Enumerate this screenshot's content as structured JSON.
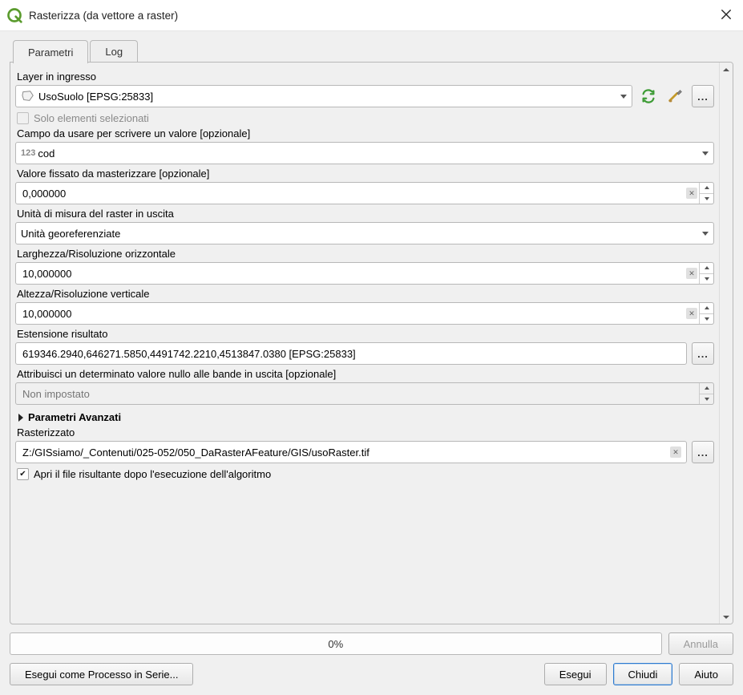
{
  "window": {
    "title": "Rasterizza (da vettore a raster)"
  },
  "tabs": {
    "parametri": "Parametri",
    "log": "Log"
  },
  "labels": {
    "layer_in": "Layer in ingresso",
    "solo_sel": "Solo elementi selezionati",
    "campo": "Campo da usare per scrivere un valore [opzionale]",
    "valore_fissato": "Valore fissato da masterizzare [opzionale]",
    "unita": "Unità di misura del raster in uscita",
    "larghezza": "Larghezza/Risoluzione orizzontale",
    "altezza": "Altezza/Risoluzione verticale",
    "estensione": "Estensione risultato",
    "nullo": "Attribuisci un determinato valore nullo alle bande in uscita [opzionale]",
    "avanzati": "Parametri Avanzati",
    "rasterizzato": "Rasterizzato",
    "apri_file": "Apri il file risultante dopo l'esecuzione dell'algoritmo"
  },
  "values": {
    "layer": "UsoSuolo [EPSG:25833]",
    "campo": "cod",
    "valore_fissato": "0,000000",
    "unita": "Unità georeferenziate",
    "larghezza": "10,000000",
    "altezza": "10,000000",
    "estensione": "619346.2940,646271.5850,4491742.2210,4513847.0380 [EPSG:25833]",
    "nullo_placeholder": "Non impostato",
    "output": "Z:/GISsiamo/_Contenuti/025-052/050_DaRasterAFeature/GIS/usoRaster.tif"
  },
  "footer": {
    "progress": "0%",
    "annulla": "Annulla",
    "batch": "Esegui come Processo in Serie...",
    "esegui": "Esegui",
    "chiudi": "Chiudi",
    "aiuto": "Aiuto"
  },
  "icons": {
    "ellipsis": "..."
  }
}
